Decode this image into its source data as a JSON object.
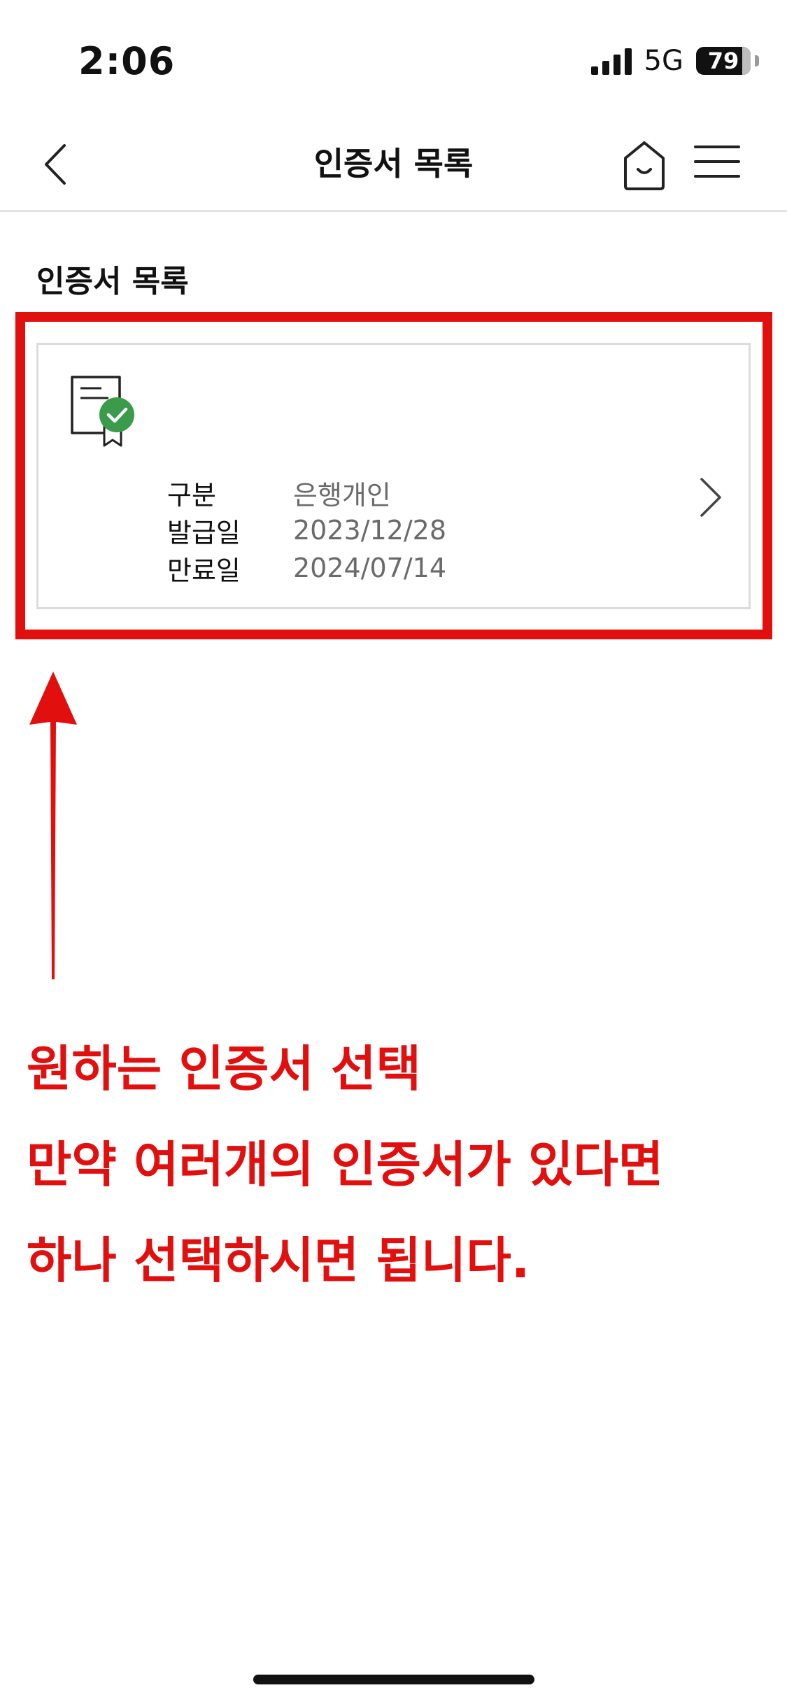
{
  "status_bar": {
    "time": "2:06",
    "network": "5G",
    "battery": "79"
  },
  "header": {
    "title": "인증서 목록",
    "back_icon": "chevron-left-icon",
    "home_icon": "home-icon",
    "menu_icon": "hamburger-menu-icon"
  },
  "section": {
    "title": "인증서 목록"
  },
  "certificates": [
    {
      "icon": "certificate-verified-icon",
      "rows": [
        {
          "label": "구분",
          "value": "은행개인"
        },
        {
          "label": "발급일",
          "value": "2023/12/28"
        },
        {
          "label": "만료일",
          "value": "2024/07/14"
        }
      ]
    }
  ],
  "annotation": {
    "color": "#e20f0f",
    "lines": [
      "원하는 인증서 선택",
      "만약 여러개의 인증서가 있다면",
      "하나 선택하시면 됩니다."
    ]
  },
  "colors": {
    "check_badge": "#3a9b4a",
    "annotation_red": "#e20f0f"
  }
}
